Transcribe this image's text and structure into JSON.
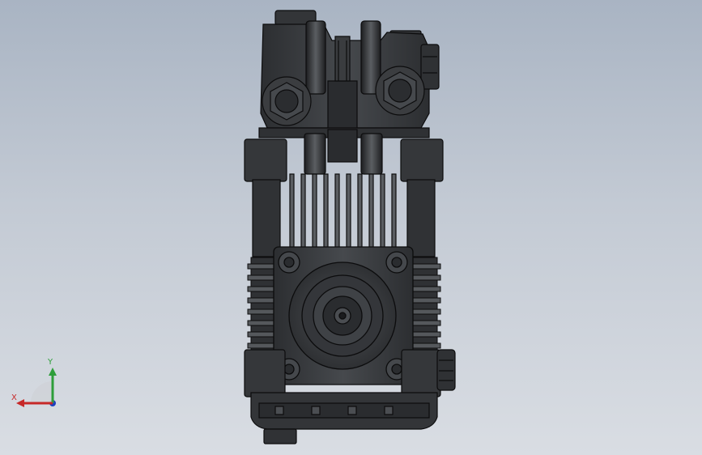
{
  "viewport": {
    "background_top": "#a9b4c3",
    "background_bottom": "#d9dde3",
    "model_fill": "#3b3d40",
    "model_dark": "#1b1c1e",
    "model_light": "#5a5d61",
    "edge_color": "#0c0c0d"
  },
  "triad": {
    "x_label": "X",
    "y_label": "Y",
    "x_color": "#c62828",
    "y_color": "#2e9e3a",
    "z_color": "#1f3fbf"
  }
}
